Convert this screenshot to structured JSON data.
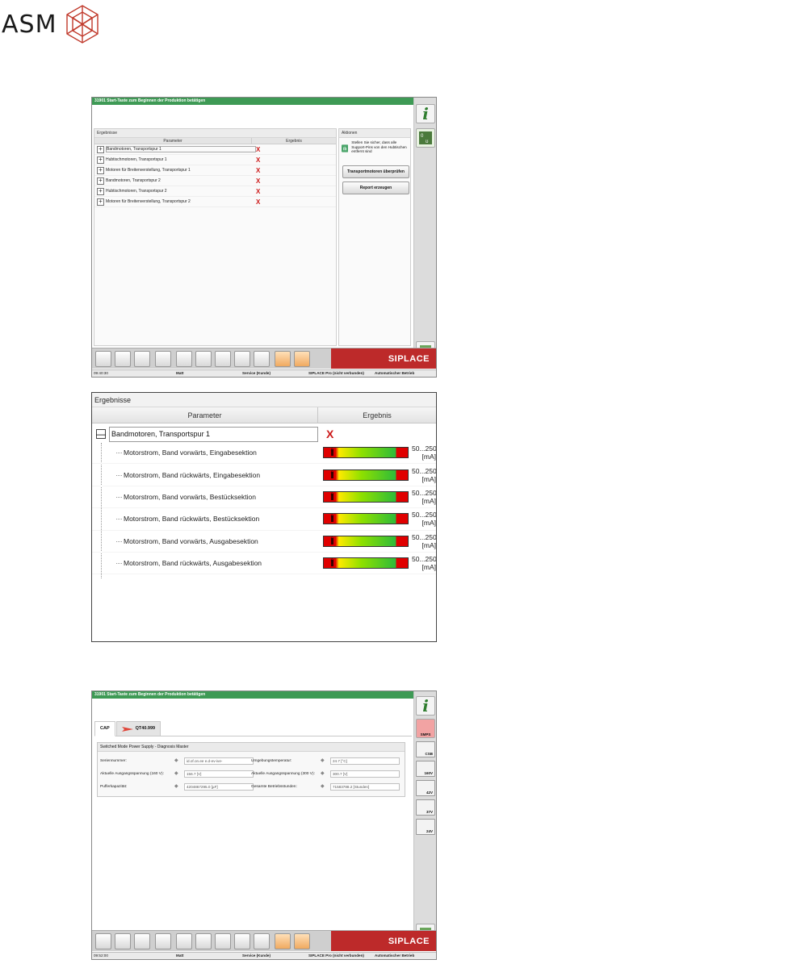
{
  "logo": {
    "text": "ASM"
  },
  "shot1": {
    "title": "31901 Start-Taste zum Beginnen der Produktion betätigen",
    "panel_header": "Ergebnisse",
    "col_parameter": "Parameter",
    "col_ergebnis": "Ergebnis",
    "rows": [
      "Bandmotoren, Transportspur 1",
      "Hubtischmotoren, Transportspur 1",
      "Motoren für Breitenverstellung, Transportspur 1",
      "Bandmotoren, Transportspur 2",
      "Hubtischmotoren, Transportspur 2",
      "Motoren für Breitenverstellung, Transportspur 2"
    ],
    "result_mark": "X",
    "actions_header": "Aktionen",
    "action_hint": "Stellen Sie sicher, dass alle Support-Pins von den Hubtischen entfernt sind",
    "btn_check": "Transportmotoren überprüfen",
    "btn_report": "Report erzeugen",
    "brand": "SIPLACE",
    "status": {
      "time": "09:40:30",
      "user": "Matt",
      "role": "Service (Kunde)",
      "conn": "SIPLACE Pro (nicht verbunden)",
      "mode": "Automatischer Betrieb"
    }
  },
  "shot2": {
    "panel_header": "Ergebnisse",
    "col_parameter": "Parameter",
    "col_ergebnis": "Ergebnis",
    "parent": "Bandmotoren, Transportspur 1",
    "collapse": "—",
    "rows": [
      {
        "label": "Motorstrom, Band vorwärts, Eingabesektion",
        "range": "50...250",
        "unit": "[mA]",
        "value": "0"
      },
      {
        "label": "Motorstrom, Band rückwärts, Eingabesektion",
        "range": "50...250",
        "unit": "[mA]",
        "value": "0"
      },
      {
        "label": "Motorstrom, Band vorwärts, Bestücksektion",
        "range": "50...250",
        "unit": "[mA]",
        "value": "0"
      },
      {
        "label": "Motorstrom, Band rückwärts, Bestücksektion",
        "range": "50...250",
        "unit": "[mA]",
        "value": "0"
      },
      {
        "label": "Motorstrom, Band vorwärts, Ausgabesektion",
        "range": "50...250",
        "unit": "[mA]",
        "value": "0"
      },
      {
        "label": "Motorstrom, Band rückwärts, Ausgabesektion",
        "range": "50...250",
        "unit": "[mA]",
        "value": "0"
      }
    ]
  },
  "shot3": {
    "title": "31901 Start-Taste zum Beginnen der Produktion betätigen",
    "tab_cap": "CAP",
    "tab_qt": "QT40.999",
    "group_title": "Switched Mode Power Supply - Diagnosis Master",
    "fields": [
      {
        "label": "Seriennummer:",
        "value": "id.of.on.ee e.d-ev-ive-"
      },
      {
        "label": "Umgebungstemperatur:",
        "value": "24.7 [°C]"
      },
      {
        "label": "Aktuelle Ausgangsspannung (160 V):",
        "value": "156.7 [V]"
      },
      {
        "label": "Aktuelle Ausgangsspannung (300 V):",
        "value": "300.7 [V]"
      },
      {
        "label": "Pufferkapazität:",
        "value": "4204867295.0 [µF]"
      },
      {
        "label": "Gesamte Betriebsstunden:",
        "value": "71583788.2 [Stunden]"
      }
    ],
    "side_buttons": [
      "SMPS",
      "CSB",
      "160V",
      "42V",
      "37V",
      "24V"
    ],
    "brand": "SIPLACE",
    "status": {
      "time": "09:52:00",
      "user": "Matt",
      "role": "Service (Kunde)",
      "conn": "SIPLACE Pro (nicht verbunden)",
      "mode": "Automatischer Betrieb"
    }
  },
  "colors": {
    "titlebar": "#3e9a55",
    "brand_red": "#bd2a2a",
    "error_red": "#cc1a1a"
  }
}
